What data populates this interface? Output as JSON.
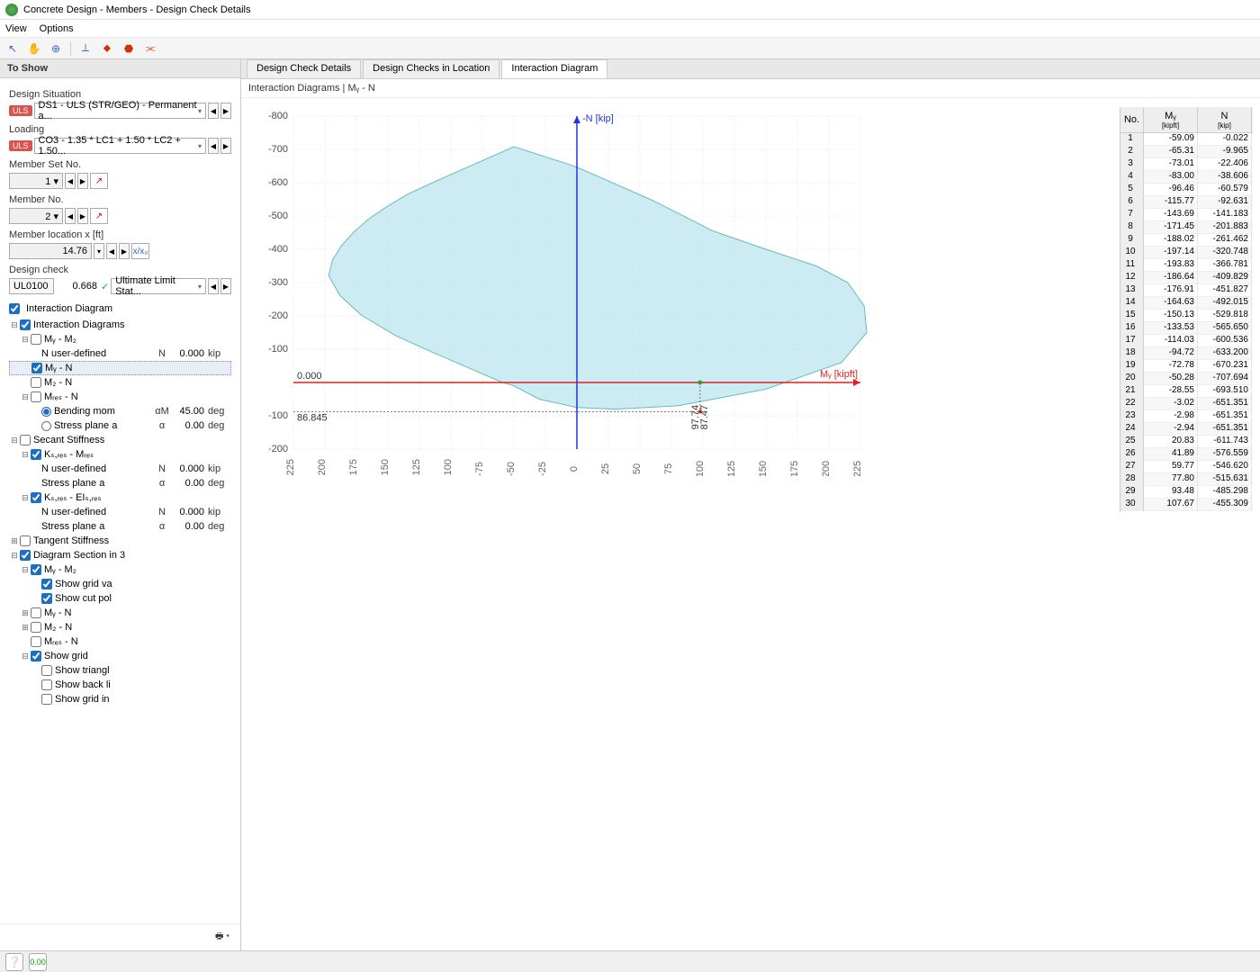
{
  "window": {
    "title": "Concrete Design - Members - Design Check Details"
  },
  "menu": {
    "view": "View",
    "options": "Options"
  },
  "sidebar": {
    "header": "To Show",
    "design_sit_label": "Design Situation",
    "design_sit_badge": "ULS",
    "design_sit_value": "DS1 - ULS (STR/GEO) - Permanent a...",
    "loading_label": "Loading",
    "loading_badge": "ULS",
    "loading_value": "CO3 - 1.35 * LC1 + 1.50 * LC2 + 1.50...",
    "member_set_label": "Member Set No.",
    "member_set_value": "1",
    "member_no_label": "Member No.",
    "member_no_value": "2",
    "member_loc_label": "Member location x [ft]",
    "member_loc_value": "14.76",
    "design_check_label": "Design check",
    "design_check_code": "UL0100",
    "design_check_ratio": "0.668",
    "design_check_desc": "Ultimate Limit Stat...",
    "interaction_diagram": "Interaction Diagram",
    "tree": {
      "interaction_diagrams": "Interaction Diagrams",
      "my_mz": "Mᵧ - M₂",
      "n_user": "N user-defined",
      "n_user_sym": "N",
      "n_user_val": "0.000",
      "n_user_unit": "kip",
      "my_n": "Mᵧ - N",
      "mz_n": "M₂ - N",
      "mres_n": "Mᵣₑₛ - N",
      "bending": "Bending mom",
      "bending_sym": "αM",
      "bending_val": "45.00",
      "bending_unit": "deg",
      "stress": "Stress plane a",
      "stress_sym": "α",
      "stress_val": "0.00",
      "stress_unit": "deg",
      "secant": "Secant Stiffness",
      "ksres_mres": "Kₛ,ᵣₑₛ - Mᵣₑₛ",
      "ksres_elsres": "Kₛ,ᵣₑₛ - EIₛ,ᵣₑₛ",
      "tangent": "Tangent Stiffness",
      "diag_section": "Diagram Section in 3",
      "show_grid_va": "Show grid va",
      "show_cut_pol": "Show cut pol",
      "show_grid": "Show grid",
      "show_triangl": "Show triangl",
      "show_back_li": "Show back li",
      "show_grid_in": "Show grid in"
    }
  },
  "tabs": {
    "t1": "Design Check Details",
    "t2": "Design Checks in Location",
    "t3": "Interaction Diagram"
  },
  "chart_title": "Interaction Diagrams | Mᵧ - N",
  "table": {
    "col_no": "No.",
    "col_my": "Mᵧ",
    "col_my_unit": "[kipft]",
    "col_n": "N",
    "col_n_unit": "[kip]",
    "rows": [
      {
        "n": 1,
        "my": "-59.09",
        "N": "-0.022"
      },
      {
        "n": 2,
        "my": "-65.31",
        "N": "-9.965"
      },
      {
        "n": 3,
        "my": "-73.01",
        "N": "-22.406"
      },
      {
        "n": 4,
        "my": "-83.00",
        "N": "-38.606"
      },
      {
        "n": 5,
        "my": "-96.46",
        "N": "-60.579"
      },
      {
        "n": 6,
        "my": "-115.77",
        "N": "-92.631"
      },
      {
        "n": 7,
        "my": "-143.69",
        "N": "-141.183"
      },
      {
        "n": 8,
        "my": "-171.45",
        "N": "-201.883"
      },
      {
        "n": 9,
        "my": "-188.02",
        "N": "-261.462"
      },
      {
        "n": 10,
        "my": "-197.14",
        "N": "-320.748"
      },
      {
        "n": 11,
        "my": "-193.83",
        "N": "-366.781"
      },
      {
        "n": 12,
        "my": "-186.64",
        "N": "-409.829"
      },
      {
        "n": 13,
        "my": "-176.91",
        "N": "-451.827"
      },
      {
        "n": 14,
        "my": "-164.63",
        "N": "-492.015"
      },
      {
        "n": 15,
        "my": "-150.13",
        "N": "-529.818"
      },
      {
        "n": 16,
        "my": "-133.53",
        "N": "-565.650"
      },
      {
        "n": 17,
        "my": "-114.03",
        "N": "-600.536"
      },
      {
        "n": 18,
        "my": "-94.72",
        "N": "-633.200"
      },
      {
        "n": 19,
        "my": "-72.78",
        "N": "-670.231"
      },
      {
        "n": 20,
        "my": "-50.28",
        "N": "-707.694"
      },
      {
        "n": 21,
        "my": "-28.55",
        "N": "-693.510"
      },
      {
        "n": 22,
        "my": "-3.02",
        "N": "-651.351"
      },
      {
        "n": 23,
        "my": "-2.98",
        "N": "-651.351"
      },
      {
        "n": 24,
        "my": "-2.94",
        "N": "-651.351"
      },
      {
        "n": 25,
        "my": "20.83",
        "N": "-611.743"
      },
      {
        "n": 26,
        "my": "41.89",
        "N": "-576.559"
      },
      {
        "n": 27,
        "my": "59.77",
        "N": "-546.620"
      },
      {
        "n": 28,
        "my": "77.80",
        "N": "-515.631"
      },
      {
        "n": 29,
        "my": "93.48",
        "N": "-485.298"
      },
      {
        "n": 30,
        "my": "107.67",
        "N": "-455.309"
      }
    ]
  },
  "chart_data": {
    "type": "area",
    "title": "Interaction Diagrams | Mᵧ - N",
    "xlabel": "Mᵧ [kipft]",
    "ylabel": "-N [kip]",
    "xlim": [
      -225,
      225
    ],
    "ylim": [
      -200,
      800
    ],
    "x_ticks": [
      -225,
      -200,
      -175,
      -150,
      -125,
      -100,
      -75,
      -50,
      -25,
      0,
      25,
      50,
      75,
      100,
      125,
      150,
      175,
      200,
      225
    ],
    "y_ticks": [
      -200,
      -100,
      0,
      100,
      200,
      300,
      400,
      500,
      600,
      700,
      800
    ],
    "marker": {
      "x": 97.74,
      "y": 87.47,
      "zero_label": "0.000",
      "y1_label": "86.845"
    },
    "polygon": [
      [
        -59,
        0
      ],
      [
        -83,
        39
      ],
      [
        -116,
        93
      ],
      [
        -144,
        141
      ],
      [
        -171,
        202
      ],
      [
        -188,
        261
      ],
      [
        -197,
        321
      ],
      [
        -194,
        367
      ],
      [
        -187,
        410
      ],
      [
        -177,
        452
      ],
      [
        -165,
        492
      ],
      [
        -150,
        530
      ],
      [
        -134,
        566
      ],
      [
        -114,
        601
      ],
      [
        -95,
        633
      ],
      [
        -50,
        708
      ],
      [
        -3,
        651
      ],
      [
        21,
        612
      ],
      [
        60,
        547
      ],
      [
        108,
        455
      ],
      [
        150,
        400
      ],
      [
        190,
        350
      ],
      [
        215,
        300
      ],
      [
        228,
        230
      ],
      [
        230,
        150
      ],
      [
        210,
        60
      ],
      [
        150,
        -20
      ],
      [
        80,
        -70
      ],
      [
        30,
        -80
      ],
      [
        0,
        -75
      ],
      [
        -30,
        -50
      ],
      [
        -50,
        -10
      ]
    ]
  }
}
